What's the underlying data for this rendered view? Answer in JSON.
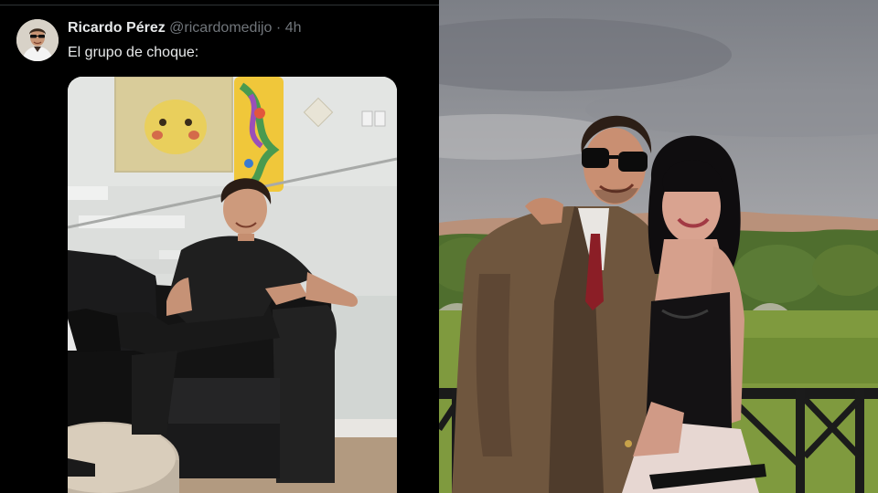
{
  "tweet": {
    "author_name": "Ricardo Pérez",
    "handle": "@ricardomedijo",
    "separator": "·",
    "time": "4h",
    "text": "El grupo de choque:"
  },
  "icons": {
    "avatar": "avatar-photo",
    "media": "photo-young-man-on-leather-armchair",
    "photo": "photo-couple-at-terrace"
  },
  "colors": {
    "background": "#000000",
    "name": "#e7e9ea",
    "meta": "#71767b"
  }
}
